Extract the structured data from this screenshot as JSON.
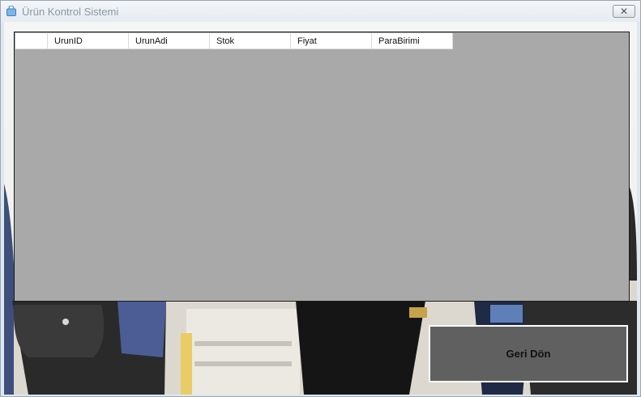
{
  "window": {
    "title": "Ürün Kontrol Sistemi",
    "close_glyph": "✕"
  },
  "grid": {
    "columns": [
      "",
      "UrunID",
      "UrunAdi",
      "Stok",
      "Fiyat",
      "ParaBirimi"
    ]
  },
  "buttons": {
    "back_label": "Geri Dön"
  },
  "icons": {
    "app": "shopping-bag-icon",
    "close": "close-icon"
  }
}
